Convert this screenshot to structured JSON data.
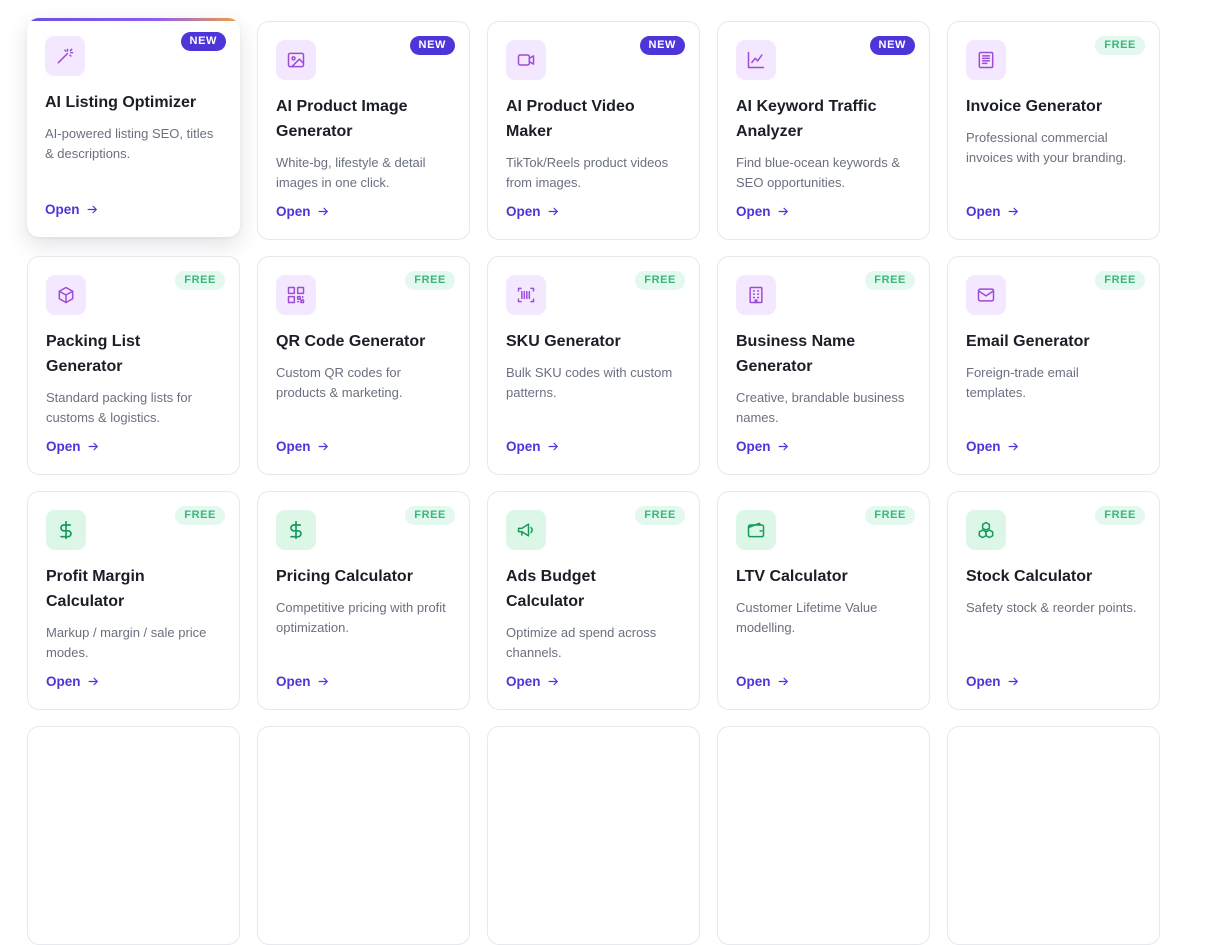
{
  "cards": [
    {
      "title": "AI Listing Optimizer",
      "desc": "AI-powered listing SEO, titles & descriptions.",
      "badge": "NEW",
      "badge_type": "new",
      "icon": "magic-wand-icon",
      "icon_color": "purple",
      "open": "Open",
      "featured": true
    },
    {
      "title": "AI Product Image Generator",
      "desc": "White-bg, lifestyle & detail images in one click.",
      "badge": "NEW",
      "badge_type": "new",
      "icon": "image-icon",
      "icon_color": "purple",
      "open": "Open"
    },
    {
      "title": "AI Product Video Maker",
      "desc": "TikTok/Reels product videos from images.",
      "badge": "NEW",
      "badge_type": "new",
      "icon": "video-icon",
      "icon_color": "purple",
      "open": "Open"
    },
    {
      "title": "AI Keyword Traffic Analyzer",
      "desc": "Find blue-ocean keywords & SEO opportunities.",
      "badge": "NEW",
      "badge_type": "new",
      "icon": "chart-line-icon",
      "icon_color": "purple",
      "open": "Open"
    },
    {
      "title": "Invoice Generator",
      "desc": "Professional commercial invoices with your branding.",
      "badge": "FREE",
      "badge_type": "free",
      "icon": "invoice-icon",
      "icon_color": "purple",
      "open": "Open"
    },
    {
      "title": "Packing List Generator",
      "desc": "Standard packing lists for customs & logistics.",
      "badge": "FREE",
      "badge_type": "free",
      "icon": "box-icon",
      "icon_color": "purple",
      "open": "Open"
    },
    {
      "title": "QR Code Generator",
      "desc": "Custom QR codes for products & marketing.",
      "badge": "FREE",
      "badge_type": "free",
      "icon": "qr-code-icon",
      "icon_color": "purple",
      "open": "Open"
    },
    {
      "title": "SKU Generator",
      "desc": "Bulk SKU codes with custom patterns.",
      "badge": "FREE",
      "badge_type": "free",
      "icon": "barcode-icon",
      "icon_color": "purple",
      "open": "Open"
    },
    {
      "title": "Business Name Generator",
      "desc": "Creative, brandable business names.",
      "badge": "FREE",
      "badge_type": "free",
      "icon": "building-icon",
      "icon_color": "purple",
      "open": "Open"
    },
    {
      "title": "Email Generator",
      "desc": "Foreign-trade email templates.",
      "badge": "FREE",
      "badge_type": "free",
      "icon": "mail-icon",
      "icon_color": "purple",
      "open": "Open"
    },
    {
      "title": "Profit Margin Calculator",
      "desc": "Markup / margin / sale price modes.",
      "badge": "FREE",
      "badge_type": "free",
      "icon": "dollar-icon",
      "icon_color": "green",
      "open": "Open"
    },
    {
      "title": "Pricing Calculator",
      "desc": "Competitive pricing with profit optimization.",
      "badge": "FREE",
      "badge_type": "free",
      "icon": "dollar-icon",
      "icon_color": "green",
      "open": "Open"
    },
    {
      "title": "Ads Budget Calculator",
      "desc": "Optimize ad spend across channels.",
      "badge": "FREE",
      "badge_type": "free",
      "icon": "megaphone-icon",
      "icon_color": "green",
      "open": "Open"
    },
    {
      "title": "LTV Calculator",
      "desc": "Customer Lifetime Value modelling.",
      "badge": "FREE",
      "badge_type": "free",
      "icon": "wallet-icon",
      "icon_color": "green",
      "open": "Open"
    },
    {
      "title": "Stock Calculator",
      "desc": "Safety stock & reorder points.",
      "badge": "FREE",
      "badge_type": "free",
      "icon": "boxes-icon",
      "icon_color": "green",
      "open": "Open"
    },
    {
      "title": "",
      "desc": "",
      "badge": "",
      "badge_type": "",
      "icon": "",
      "icon_color": "",
      "open": ""
    },
    {
      "title": "",
      "desc": "",
      "badge": "",
      "badge_type": "",
      "icon": "",
      "icon_color": "",
      "open": ""
    },
    {
      "title": "",
      "desc": "",
      "badge": "",
      "badge_type": "",
      "icon": "",
      "icon_color": "",
      "open": ""
    },
    {
      "title": "",
      "desc": "",
      "badge": "",
      "badge_type": "",
      "icon": "",
      "icon_color": "",
      "open": ""
    },
    {
      "title": "",
      "desc": "",
      "badge": "",
      "badge_type": "",
      "icon": "",
      "icon_color": "",
      "open": ""
    }
  ]
}
